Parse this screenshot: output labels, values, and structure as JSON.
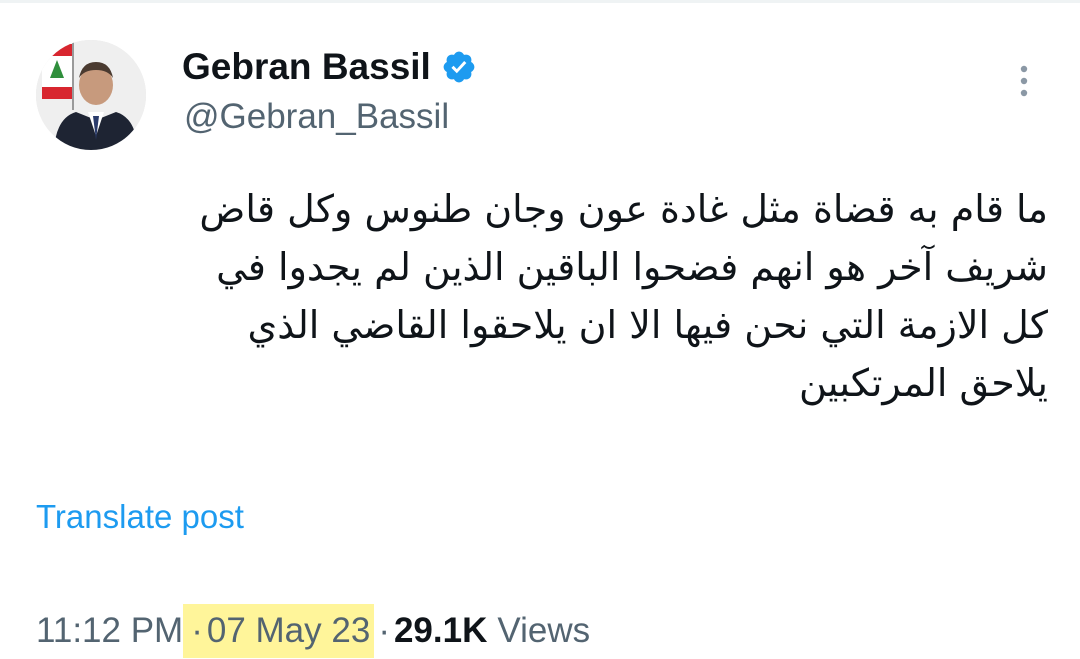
{
  "author": {
    "display_name": "Gebran Bassil",
    "handle": "@Gebran_Bassil",
    "verified": true,
    "avatar_icon": "profile-photo"
  },
  "post": {
    "text": "ما قام به قضاة مثل غادة عون وجان طنوس وكل قاض\nشريف آخر هو انهم فضحوا الباقين الذين لم يجدوا في\nكل الازمة التي نحن فيها الا ان يلاحقوا القاضي الذي\nيلاحق المرتكبين",
    "translate_label": "Translate post"
  },
  "meta": {
    "time": "11:12 PM",
    "separator": "·",
    "date": "07 May 23",
    "views_count": "29.1K",
    "views_label": "Views"
  },
  "colors": {
    "accent": "#1d9bf0",
    "secondary_text": "#536471",
    "date_highlight": "#fff59a"
  },
  "icons": {
    "verified": "verified-badge-icon",
    "more": "more-vertical-icon"
  }
}
